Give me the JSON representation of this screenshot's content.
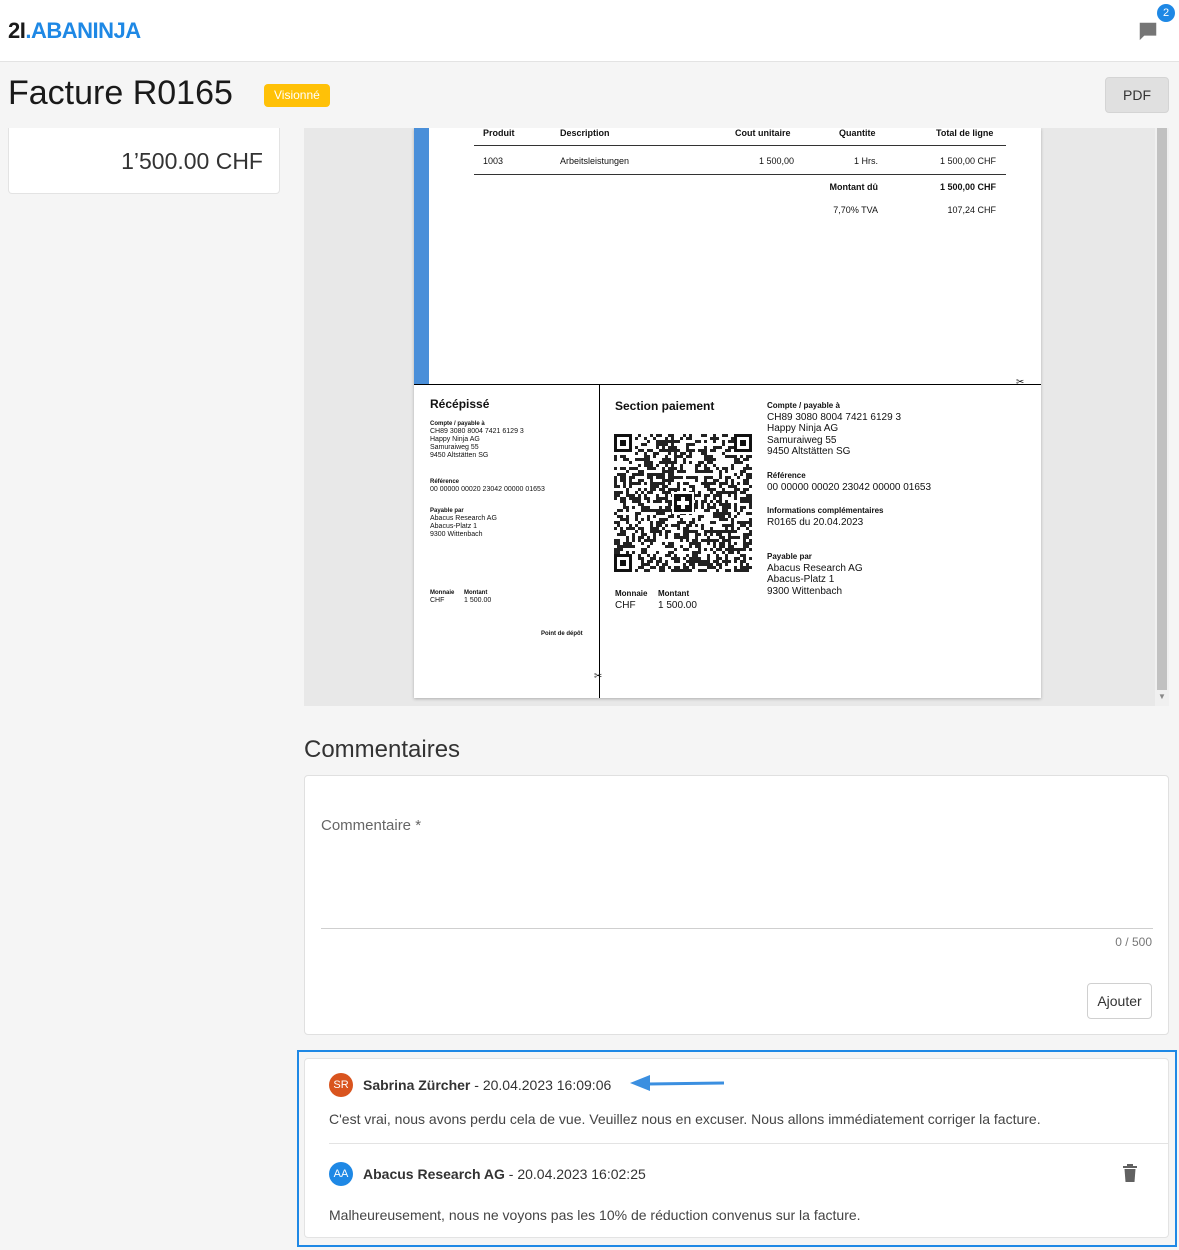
{
  "header": {
    "logo_num": "2",
    "logo_i": "I",
    "logo_dot": ".",
    "logo_brand": "ABANINJA",
    "notification_count": "2",
    "brand_color": "#1e88e5"
  },
  "title": {
    "text": "Facture R0165",
    "status": "Visionné",
    "status_color": "#ffc107",
    "pdf_label": "PDF"
  },
  "amount": "1’500.00 CHF",
  "invoice": {
    "columns": [
      "Produit",
      "Description",
      "Cout unitaire",
      "Quantite",
      "Total de ligne"
    ],
    "row": {
      "product": "1003",
      "description": "Arbeitsleistungen",
      "unit_cost": "1 500,00",
      "quantity": "1 Hrs.",
      "total": "1 500,00 CHF"
    },
    "amount_due_label": "Montant dû",
    "amount_due": "1 500,00 CHF",
    "vat_label": "7,70% TVA",
    "vat": "107,24 CHF"
  },
  "receipt": {
    "title": "Récépissé",
    "account_label": "Compte / payable à",
    "account_lines": [
      "CH89 3080 8004 7421 6129 3",
      "Happy Ninja AG",
      "Samuraiweg 55",
      "9450 Altstätten SG"
    ],
    "reference_label": "Référence",
    "reference": "00 00000 00020 23042 00000 01653",
    "payer_label": "Payable par",
    "payer_lines": [
      "Abacus Research AG",
      "Abacus-Platz 1",
      "9300 Wittenbach"
    ],
    "currency_label": "Monnaie",
    "currency": "CHF",
    "amount_label": "Montant",
    "amount": "1 500.00",
    "deposit_label": "Point de dépôt"
  },
  "payment": {
    "title": "Section paiement",
    "account_label": "Compte / payable à",
    "account_lines": [
      "CH89 3080 8004 7421 6129 3",
      "Happy Ninja AG",
      "Samuraiweg 55",
      "9450 Altstätten SG"
    ],
    "reference_label": "Référence",
    "reference": "00 00000 00020 23042 00000 01653",
    "info_label": "Informations complémentaires",
    "info": "R0165 du 20.04.2023",
    "payer_label": "Payable par",
    "payer_lines": [
      "Abacus Research AG",
      "Abacus-Platz 1",
      "9300 Wittenbach"
    ],
    "currency_label": "Monnaie",
    "currency": "CHF",
    "amount_label": "Montant",
    "amount": "1 500.00"
  },
  "comments": {
    "title": "Commentaires",
    "field_label": "Commentaire *",
    "counter": "0 / 500",
    "add_label": "Ajouter",
    "items": [
      {
        "initials": "SR",
        "avatar_color": "#d9541e",
        "author": "Sabrina Zürcher",
        "timestamp": " - 20.04.2023 16:09:06",
        "text": "C'est vrai, nous avons perdu cela de vue. Veuillez nous en excuser. Nous allons immédiatement corriger la facture."
      },
      {
        "initials": "AA",
        "avatar_color": "#1e88e5",
        "author": "Abacus Research AG",
        "timestamp": " - 20.04.2023 16:02:25",
        "text": "Malheureusement, nous ne voyons pas les 10% de réduction convenus sur la facture."
      }
    ]
  }
}
